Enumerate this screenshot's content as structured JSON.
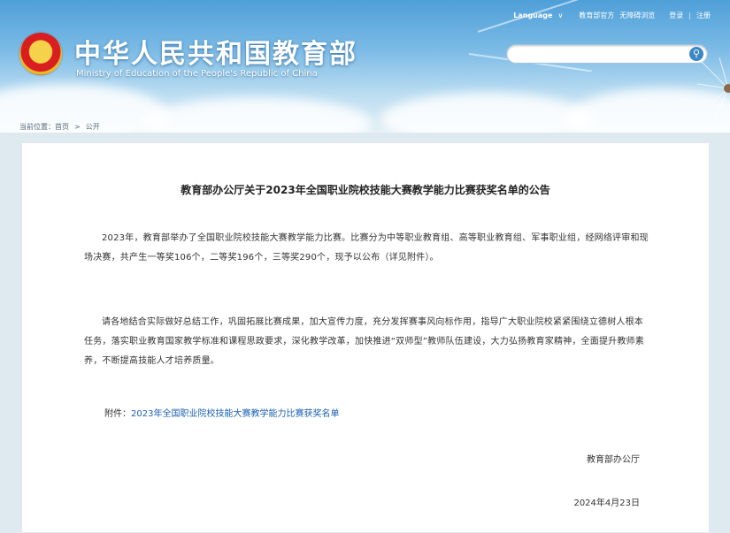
{
  "header": {
    "title": "中华人民共和国教育部",
    "subtitle": "Ministry of Education of the People's Republic of China",
    "nav": {
      "language": "Language",
      "link1": "教育部官方",
      "link2": "无障碍浏览",
      "login": "登录",
      "register": "注册"
    },
    "search": {
      "placeholder": ""
    }
  },
  "breadcrumb": [
    "当前位置：首页",
    "公开"
  ],
  "article": {
    "title": "教育部办公厅关于2023年全国职业院校技能大赛教学能力比赛获奖名单的公告",
    "paragraph1": "2023年，教育部举办了全国职业院校技能大赛教学能力比赛。比赛分为中等职业教育组、高等职业教育组、军事职业组，经网络评审和现场决赛，共产生一等奖106个，二等奖196个，三等奖290个，现予以公布（详见附件）。",
    "paragraph2": "请各地结合实际做好总结工作，巩固拓展比赛成果，加大宣传力度，充分发挥赛事风向标作用，指导广大职业院校紧紧围绕立德树人根本任务，落实职业教育国家教学标准和课程思政要求，深化教学改革，加快推进“双师型”教师队伍建设，大力弘扬教育家精神，全面提升教师素养，不断提高技能人才培养质量。",
    "attachment_label": "附件：",
    "attachment_link": "2023年全国职业院校技能大赛教学能力比赛获奖名单",
    "signer": "教育部办公厅",
    "date": "2024年4月23日"
  },
  "colors": {
    "header_blue": "#4f9fd8",
    "link_blue": "#1a5fb4",
    "search_button": "#3c87c6"
  }
}
